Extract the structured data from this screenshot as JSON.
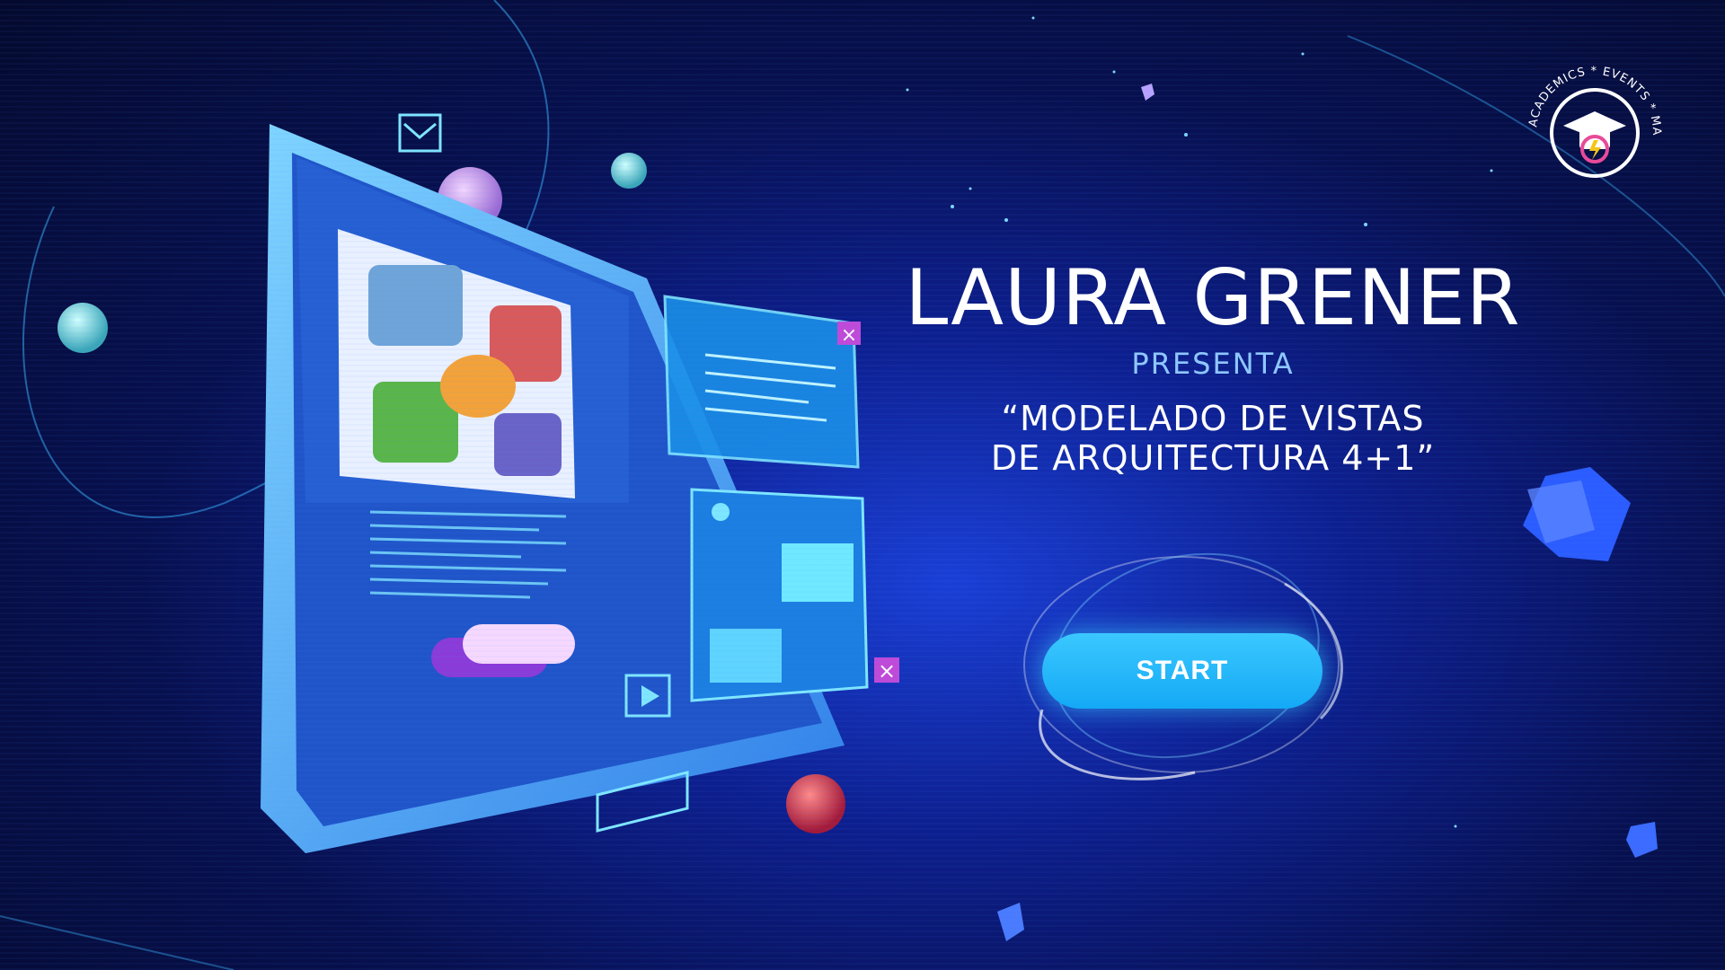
{
  "title": "LAURA GRENER",
  "presenta": "PRESENTA",
  "subtitle_line1": "“MODELADO DE VISTAS",
  "subtitle_line2": "DE ARQUITECTURA 4+1”",
  "start_label": "START",
  "logo": {
    "text": "ACADEMICS * EVENTS * MANAGER",
    "icon": "graduation-cap-icon"
  },
  "colors": {
    "accent": "#14a9f5",
    "background": "#07104f",
    "presenta": "#8ec7ff"
  }
}
